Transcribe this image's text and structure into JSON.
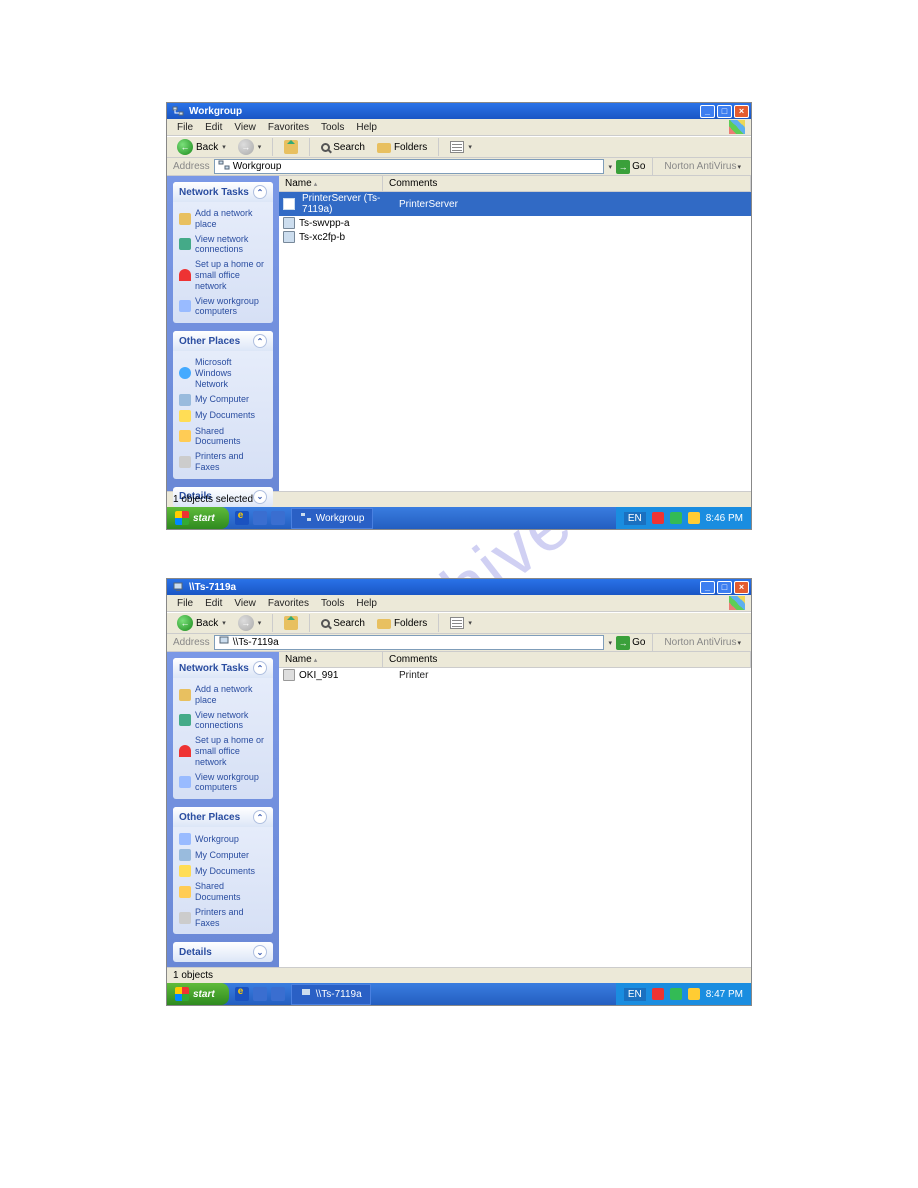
{
  "watermark": "manualshive.com",
  "menu": {
    "file": "File",
    "edit": "Edit",
    "view": "View",
    "favorites": "Favorites",
    "tools": "Tools",
    "help": "Help"
  },
  "toolbar": {
    "back": "Back",
    "search": "Search",
    "folders": "Folders"
  },
  "address": {
    "label": "Address",
    "go": "Go",
    "norton": "Norton AntiVirus"
  },
  "cols": {
    "name": "Name",
    "comments": "Comments"
  },
  "panels": {
    "network_tasks": "Network Tasks",
    "other_places": "Other Places",
    "details": "Details",
    "links1": {
      "add": "Add a network place",
      "conn": "View network connections",
      "home": "Set up a home or small office network",
      "comps": "View workgroup computers"
    },
    "places1": {
      "msnet": "Microsoft Windows Network",
      "mycomp": "My Computer",
      "docs": "My Documents",
      "shared": "Shared Documents",
      "prn": "Printers and Faxes"
    },
    "places2": {
      "wg": "Workgroup",
      "mycomp": "My Computer",
      "docs": "My Documents",
      "shared": "Shared Documents",
      "prn": "Printers and Faxes"
    }
  },
  "win1": {
    "title": "Workgroup",
    "address": "Workgroup",
    "rows": [
      {
        "name": "PrinterServer (Ts-7119a)",
        "comment": "PrinterServer"
      },
      {
        "name": "Ts-swvpp-a",
        "comment": ""
      },
      {
        "name": "Ts-xc2fp-b",
        "comment": ""
      }
    ],
    "status": "1 objects selected",
    "task": "Workgroup",
    "time": "8:46 PM"
  },
  "win2": {
    "title": "\\\\Ts-7119a",
    "address": "\\\\Ts-7119a",
    "rows": [
      {
        "name": "OKI_991",
        "comment": "Printer"
      }
    ],
    "status": "1 objects",
    "task": "\\\\Ts-7119a",
    "time": "8:47 PM"
  },
  "tray": {
    "lang": "EN"
  }
}
